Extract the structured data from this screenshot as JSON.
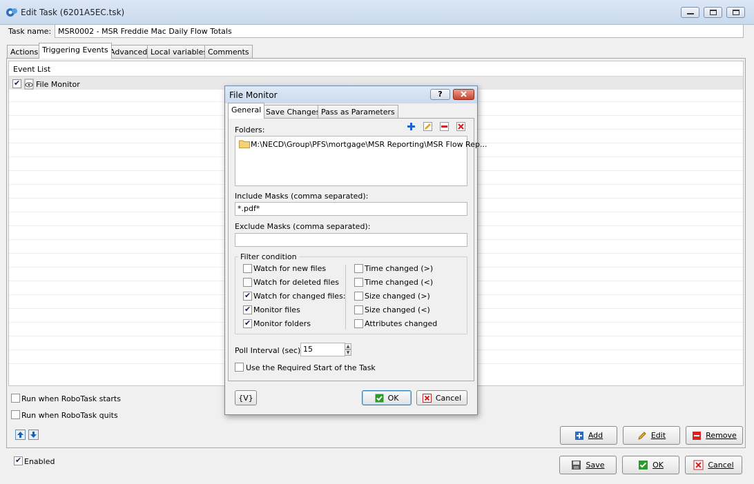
{
  "window": {
    "title": "Edit Task (6201A5EC.tsk)"
  },
  "task_name": {
    "label": "Task name:",
    "value": "MSR0002 - MSR Freddie Mac Daily Flow Totals"
  },
  "tabs": [
    "Actions",
    "Triggering Events",
    "Advanced",
    "Local variables",
    "Comments"
  ],
  "event_list": {
    "header": "Event List",
    "items": [
      {
        "label": "File Monitor",
        "checked": true
      }
    ]
  },
  "options": {
    "run_on_start": "Run when RoboTask starts",
    "run_on_quit": "Run when RoboTask quits",
    "enabled": "Enabled"
  },
  "buttons": {
    "add": "Add",
    "edit": "Edit",
    "remove": "Remove",
    "save": "Save",
    "ok": "OK",
    "cancel": "Cancel"
  },
  "dialog": {
    "title": "File Monitor",
    "help": "?",
    "tabs": [
      "General",
      "Save Changes",
      "Pass as Parameters"
    ],
    "folders_label": "Folders:",
    "folders": [
      "M:\\NECD\\Group\\PFS\\mortgage\\MSR Reporting\\MSR Flow Rep..."
    ],
    "include_label": "Include Masks (comma separated):",
    "include_value": "*.pdf*",
    "exclude_label": "Exclude Masks (comma separated):",
    "exclude_value": "",
    "filter_legend": "Filter condition",
    "filters_left": [
      {
        "label": "Watch for new files",
        "checked": false
      },
      {
        "label": "Watch for deleted files",
        "checked": false
      },
      {
        "label": "Watch for changed files:",
        "checked": true
      },
      {
        "label": "Monitor files",
        "checked": true
      },
      {
        "label": "Monitor folders",
        "checked": true
      }
    ],
    "filters_right": [
      {
        "label": "Time changed (>)",
        "checked": false
      },
      {
        "label": "Time changed (<)",
        "checked": false
      },
      {
        "label": "Size changed (>)",
        "checked": false
      },
      {
        "label": "Size changed (<)",
        "checked": false
      },
      {
        "label": "Attributes changed",
        "checked": false
      }
    ],
    "poll_label": "Poll Interval (sec):",
    "poll_value": "15",
    "required_start": "Use the Required Start of the Task",
    "vars_button": "{V}",
    "ok": "OK",
    "cancel": "Cancel"
  }
}
